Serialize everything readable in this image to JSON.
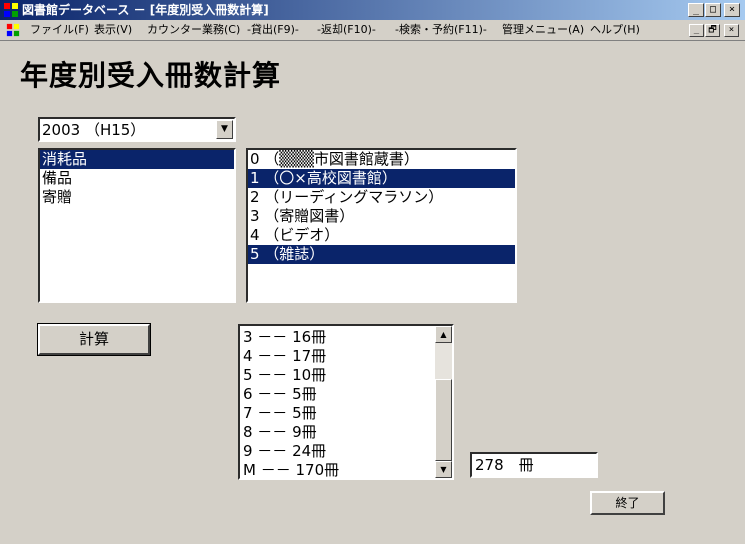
{
  "window": {
    "title": "図書館データベース － [年度別受入冊数計算]",
    "minimize": "_",
    "maximize": "□",
    "close": "×",
    "restore": "🗗"
  },
  "menu": {
    "items": [
      "ファイル(F)",
      "表示(V)",
      "カウンター業務(C)",
      "-貸出(F9)-",
      "-返却(F10)-",
      "-検索・予約(F11)-",
      "管理メニュー(A)",
      "ヘルプ(H)"
    ]
  },
  "page": {
    "title": "年度別受入冊数計算"
  },
  "year_combo": {
    "value": "2003 （H15）"
  },
  "category_list": {
    "items": [
      "消耗品",
      "備品",
      "寄贈"
    ],
    "selected_index": 0
  },
  "source_list": {
    "items": [
      "0 （▒▒▒市図書館蔵書）",
      "1 （〇×高校図書館）",
      "2 （リーディングマラソン）",
      "3 （寄贈図書）",
      "4 （ビデオ）",
      "5 （雑誌）"
    ],
    "selected_indices": [
      1,
      5
    ]
  },
  "buttons": {
    "calc": "計算",
    "exit": "終了"
  },
  "result_list": {
    "items": [
      "3 －－ 16冊",
      "4 －－ 17冊",
      "5 －－ 10冊",
      "6 －－ 5冊",
      "7 －－ 5冊",
      "8 －－ 9冊",
      "9 －－ 24冊",
      "M －－ 170冊"
    ]
  },
  "total": {
    "value": "278　冊"
  },
  "colors": {
    "selection": "#0a246a",
    "face": "#d4d0c8",
    "title_gradient_start": "#0a246a",
    "title_gradient_end": "#a6caf0"
  }
}
